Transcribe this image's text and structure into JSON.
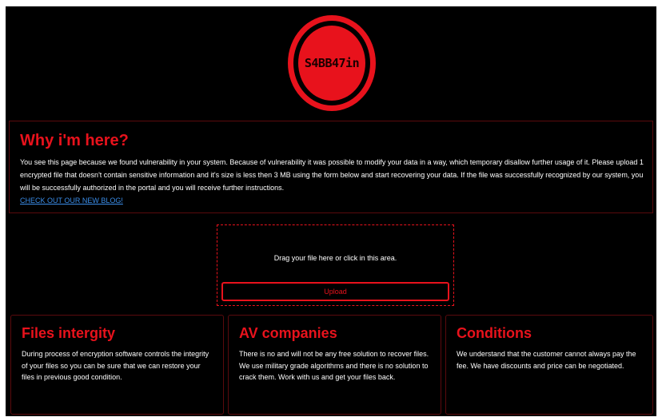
{
  "logo": {
    "text": "S4BB47in"
  },
  "why": {
    "title": "Why i'm here?",
    "body": "You see this page because we found vulnerability in your system. Because of vulnerability it was possible to modify your data in a way, which temporary disallow further usage of it. Please upload 1 encrypted file that doesn't contain sensitive information and it's size is less then 3 MB using the form below and start recovering your data. If the file was successfully recognized by our system, you will be successfully authorized in the portal and you will receive further instructions.",
    "link_label": "CHECK OUT OUR NEW BLOG!"
  },
  "upload": {
    "drop_text": "Drag your file here or click in this area.",
    "button_label": "Upload"
  },
  "cards": [
    {
      "title": "Files intergity",
      "text": "During process of encryption software controls the integrity of your files so you can be sure that we can restore your files in previous good condition."
    },
    {
      "title": "AV companies",
      "text": "There is no and will not be any free solution to recover files. We use military grade algorithms and there is no solution to crack them. Work with us and get your files back."
    },
    {
      "title": "Conditions",
      "text": "We understand that the customer cannot always pay the fee. We have discounts and price can be negotiated."
    }
  ],
  "colors": {
    "accent": "#e8121c",
    "background": "#000000",
    "link": "#3b8eea",
    "border": "#5a0a0d"
  }
}
